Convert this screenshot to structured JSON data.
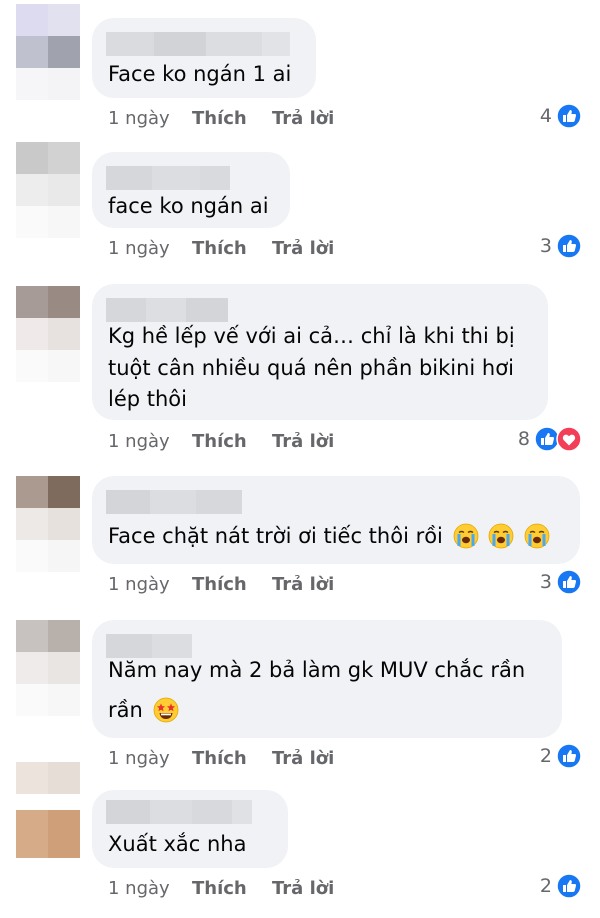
{
  "colors": {
    "bubble": "#f0f2f5",
    "meta_text": "#65676b",
    "like_blue": "#1877f2",
    "love_red": "#f33e58"
  },
  "comments": [
    {
      "text_lines": [
        "Face ko ngán 1 ai"
      ],
      "time": "1 ngày",
      "like_label": "Thích",
      "reply_label": "Trả lời",
      "reaction_count": "4",
      "reactions": [
        "like-icon"
      ]
    },
    {
      "text_lines": [
        "face ko ngán ai"
      ],
      "time": "1 ngày",
      "like_label": "Thích",
      "reply_label": "Trả lời",
      "reaction_count": "3",
      "reactions": [
        "like-icon"
      ]
    },
    {
      "text_lines": [
        "Kg hề lếp vế với ai cả… chỉ là khi thi bị",
        "tuột cân nhiều quá nên phần bikini hơi",
        "lép thôi"
      ],
      "time": "1 ngày",
      "like_label": "Thích",
      "reply_label": "Trả lời",
      "reaction_count": "8",
      "reactions": [
        "like-icon",
        "love-icon"
      ]
    },
    {
      "text_lines": [
        "Face chặt nát trời ơi tiếc thôi rồi"
      ],
      "emojis": [
        "loudly-crying-face",
        "loudly-crying-face",
        "loudly-crying-face"
      ],
      "time": "1 ngày",
      "like_label": "Thích",
      "reply_label": "Trả lời",
      "reaction_count": "3",
      "reactions": [
        "like-icon"
      ]
    },
    {
      "text_lines": [
        "Năm nay mà 2 bả làm gk MUV chắc rần",
        "rần"
      ],
      "emojis": [
        "star-struck-face"
      ],
      "time": "1 ngày",
      "like_label": "Thích",
      "reply_label": "Trả lời",
      "reaction_count": "2",
      "reactions": [
        "like-icon"
      ]
    },
    {
      "text_lines": [
        "Xuất xắc nha"
      ],
      "time": "1 ngày",
      "like_label": "Thích",
      "reply_label": "Trả lời",
      "reaction_count": "2",
      "reactions": [
        "like-icon"
      ]
    }
  ]
}
